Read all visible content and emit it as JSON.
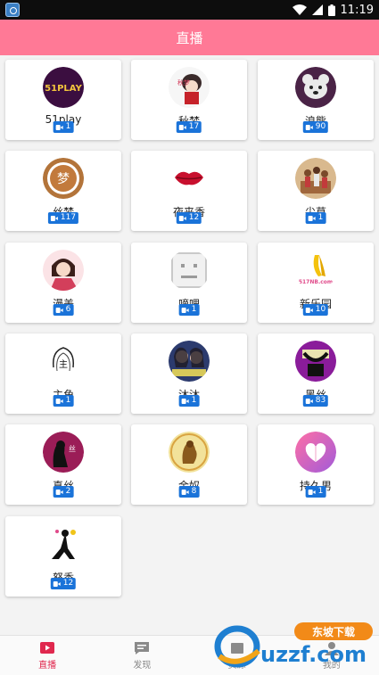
{
  "status_bar": {
    "time": "11:19",
    "icons": [
      "wifi-icon",
      "signal-icon",
      "battery-icon"
    ]
  },
  "header": {
    "title": "直播"
  },
  "colors": {
    "header": "#ff7996",
    "badge": "#1a73d9",
    "nav_active": "#e0284e"
  },
  "channels": [
    {
      "name": "51play",
      "count": "1",
      "logo_text": "51PLAY"
    },
    {
      "name": "秋梦",
      "count": "17",
      "logo_text": "秋梦"
    },
    {
      "name": "浪熊",
      "count": "90",
      "logo_text": ""
    },
    {
      "name": "丝梦",
      "count": "117",
      "logo_text": "梦"
    },
    {
      "name": "夜来香",
      "count": "12",
      "logo_text": ""
    },
    {
      "name": "尖草",
      "count": "1",
      "logo_text": ""
    },
    {
      "name": "漫美",
      "count": "6",
      "logo_text": ""
    },
    {
      "name": "嘀哩",
      "count": "1",
      "logo_text": ""
    },
    {
      "name": "新乐园",
      "count": "10",
      "logo_text": "517NB.com"
    },
    {
      "name": "主角",
      "count": "1",
      "logo_text": "主"
    },
    {
      "name": "沐沐",
      "count": "1",
      "logo_text": ""
    },
    {
      "name": "黑丝",
      "count": "83",
      "logo_text": ""
    },
    {
      "name": "真丝",
      "count": "2",
      "logo_text": "丝"
    },
    {
      "name": "金奴",
      "count": "8",
      "logo_text": ""
    },
    {
      "name": "持久男",
      "count": "1",
      "logo_text": ""
    },
    {
      "name": "怒香",
      "count": "12",
      "logo_text": ""
    }
  ],
  "bottom_nav": [
    {
      "label": "直播",
      "icon": "live-icon",
      "active": true
    },
    {
      "label": "发现",
      "icon": "discover-icon",
      "active": false
    },
    {
      "label": "资源",
      "icon": "resource-icon",
      "active": false
    },
    {
      "label": "我的",
      "icon": "profile-icon",
      "active": false
    }
  ],
  "watermark": {
    "brand": "uzzf.com",
    "tagline": "东坡下载"
  }
}
